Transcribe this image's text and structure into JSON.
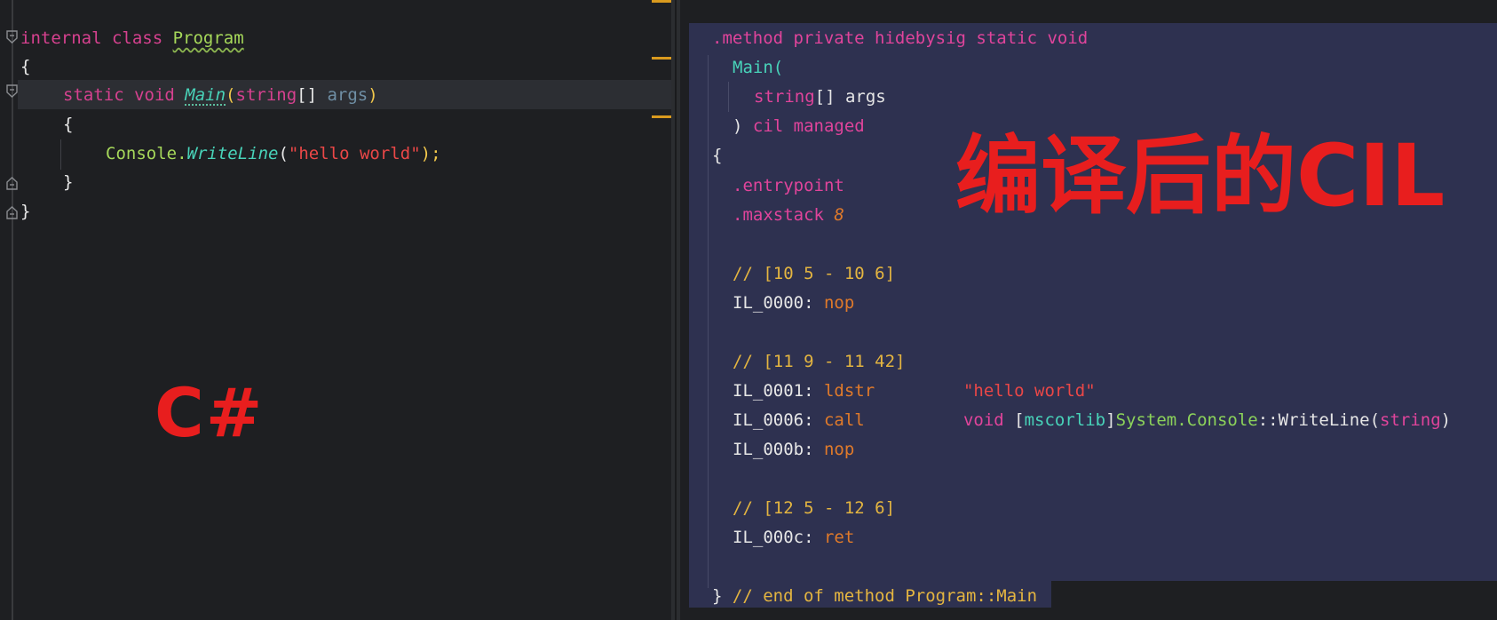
{
  "csharp": {
    "line1": {
      "kw": "internal class ",
      "name": "Program"
    },
    "line2": "{",
    "line3": {
      "kw": "static void ",
      "name": "Main",
      "open": "(",
      "type": "string",
      "arr": "[] ",
      "param": "args",
      "close": ")"
    },
    "line4": "{",
    "line5": {
      "obj": "Console.",
      "method": "WriteLine",
      "open": "(",
      "str": "\"hello world\"",
      "close": ");"
    },
    "line6": "}",
    "line7": "}"
  },
  "cil": {
    "l1": ".method private hidebysig static void",
    "l2": "Main(",
    "l3": {
      "type": "string",
      "rest": "[] args"
    },
    "l4": {
      "paren": ") ",
      "kw": "cil managed"
    },
    "l5": "{",
    "l6": ".entrypoint",
    "l7": {
      "kw": ".maxstack ",
      "num": "8"
    },
    "c1": "// [10 5 - 10 6]",
    "i1": {
      "label": "IL_0000: ",
      "op": "nop"
    },
    "c2": "// [11 9 - 11 42]",
    "i2": {
      "label": "IL_0001: ",
      "op": "ldstr",
      "arg": "\"hello world\""
    },
    "i3": {
      "label": "IL_0006: ",
      "op": "call",
      "void": "void ",
      "br1": "[",
      "asm": "mscorlib",
      "br2": "]",
      "cls": "System.Console",
      "sep": "::",
      "method": "WriteLine(",
      "type": "string",
      "close": ")"
    },
    "i4": {
      "label": "IL_000b: ",
      "op": "nop"
    },
    "c3": "// [12 5 - 12 6]",
    "i5": {
      "label": "IL_000c: ",
      "op": "ret"
    },
    "end": {
      "brace": "} ",
      "comment": "// end of method Program::Main"
    }
  },
  "labels": {
    "csharp": "C#",
    "cil": "编译后的CIL"
  },
  "colors": {
    "keyword": "#d6418f",
    "class": "#a6d85a",
    "method": "#48d3b9",
    "string": "#ea4747",
    "comment": "#e4b540",
    "opcode": "#e07a2a",
    "label": "#e81e1e"
  }
}
